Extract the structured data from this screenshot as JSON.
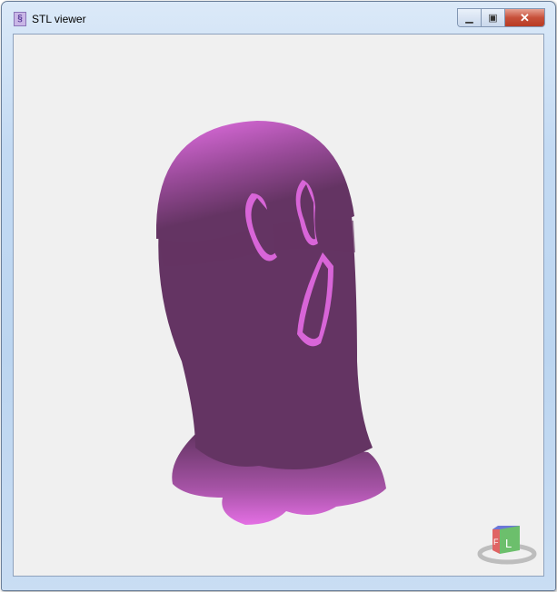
{
  "window": {
    "title": "STL viewer",
    "app_icon": "stl-icon"
  },
  "controls": {
    "minimize": "minimize-icon",
    "maximize": "maximize-icon",
    "close": "close-icon"
  },
  "view_cube": {
    "front_label": "F",
    "left_label": "L"
  },
  "colors": {
    "model_dark": "#643463",
    "model_light": "#e46fe4",
    "background": "#f0f0f0"
  }
}
